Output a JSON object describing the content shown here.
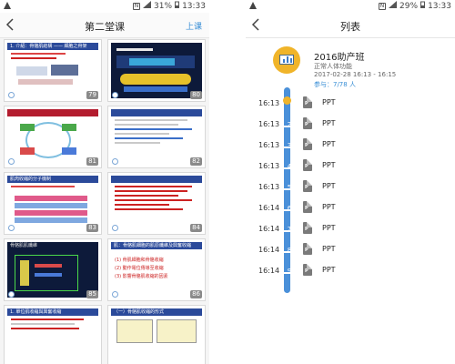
{
  "left_screen": {
    "status": {
      "battery": "31%",
      "time": "13:33"
    },
    "title": "第二堂课",
    "action": "上课",
    "slides": [
      {
        "num": "79",
        "header": "1. 介紹：骨骼肌結構 —— 細胞之骨架"
      },
      {
        "num": "80",
        "header": ""
      },
      {
        "num": "81",
        "header": ""
      },
      {
        "num": "82",
        "header": ""
      },
      {
        "num": "83",
        "header": "肌肉收縮的分子機制"
      },
      {
        "num": "84",
        "header": ""
      },
      {
        "num": "85",
        "header": "骨骼肌肌纖維"
      },
      {
        "num": "86",
        "header": "肌：骨骼肌細胞的肌原纖維及興奮收縮"
      },
      {
        "num": "",
        "header": "1. 單位肌收縮與興奮收縮"
      },
      {
        "num": "",
        "header": "（一）骨骼肌收縮的形式"
      }
    ],
    "slide86_lines": [
      "(1) 骨肌細胞和骨骼收縮",
      "(2) 動作電位傳導至收縮",
      "(3) 影響骨骼肌收縮的因素"
    ]
  },
  "right_screen": {
    "status": {
      "battery": "29%",
      "time": "13:33"
    },
    "title": "列表",
    "course": {
      "name": "2016助产班",
      "subtitle": "正常人体功能",
      "time": "2017-02-28 16:13 - 16:15",
      "attendance": "参与：7/78 人"
    },
    "items": [
      {
        "time": "16:13",
        "index": "1",
        "label": "PPT"
      },
      {
        "time": "16:13",
        "index": "2",
        "label": "PPT"
      },
      {
        "time": "16:13",
        "index": "3",
        "label": "PPT"
      },
      {
        "time": "16:13",
        "index": "4",
        "label": "PPT"
      },
      {
        "time": "16:13",
        "index": "5",
        "label": "PPT"
      },
      {
        "time": "16:14",
        "index": "6",
        "label": "PPT"
      },
      {
        "time": "16:14",
        "index": "7",
        "label": "PPT"
      },
      {
        "time": "16:14",
        "index": "8",
        "label": "PPT"
      },
      {
        "time": "16:14",
        "index": "9",
        "label": "PPT"
      }
    ],
    "file_icon_letter": "P"
  }
}
